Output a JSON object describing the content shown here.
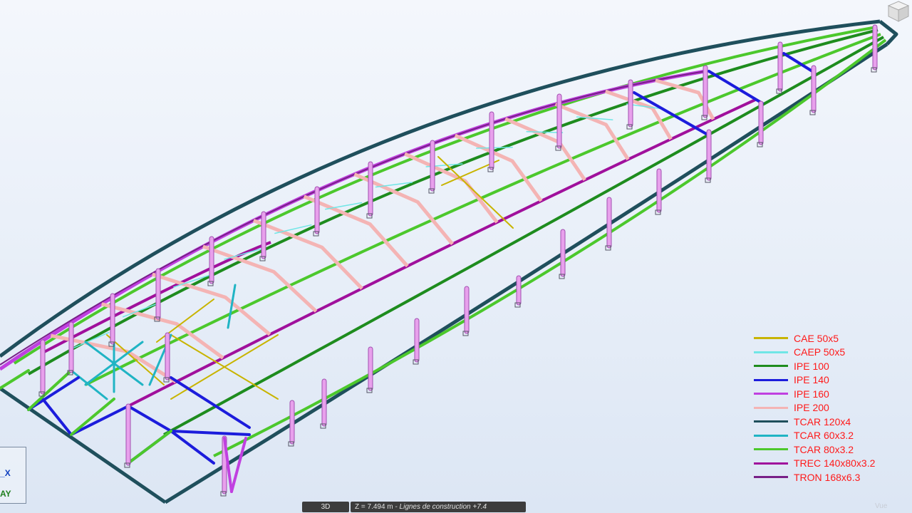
{
  "legend": [
    {
      "label": "CAE 50x5",
      "color": "#c8b400"
    },
    {
      "label": "CAEP 50x5",
      "color": "#70e6e6"
    },
    {
      "label": "IPE 100",
      "color": "#1e8c1e"
    },
    {
      "label": "IPE 140",
      "color": "#1c1cdc"
    },
    {
      "label": "IPE 160",
      "color": "#c040e0"
    },
    {
      "label": "IPE 200",
      "color": "#f4b4b4"
    },
    {
      "label": "TCAR 120x4",
      "color": "#1f4f5c"
    },
    {
      "label": "TCAR 60x3.2",
      "color": "#20b4c4"
    },
    {
      "label": "TCAR 80x3.2",
      "color": "#4cc82c"
    },
    {
      "label": "TREC 140x80x3.2",
      "color": "#a0109c"
    },
    {
      "label": "TRON 168x6.3",
      "color": "#782088"
    }
  ],
  "axes": {
    "x": "X",
    "y": "Y"
  },
  "statusbar": {
    "view_mode": "3D",
    "coord": "Z = 7.494 m",
    "info": "- Lignes de construction +7.4",
    "view": "Vue"
  },
  "colors": {
    "column": "#e8a0ec",
    "column_edge": "#a050b0"
  }
}
